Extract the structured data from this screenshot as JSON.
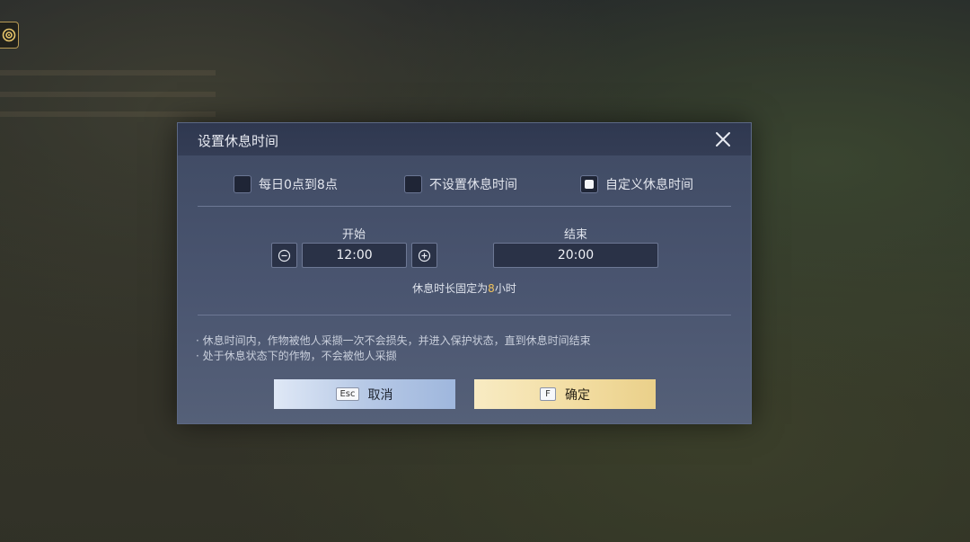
{
  "dialog": {
    "title": "设置休息时间",
    "options": [
      {
        "label": "每日0点到8点",
        "checked": false
      },
      {
        "label": "不设置休息时间",
        "checked": false
      },
      {
        "label": "自定义休息时间",
        "checked": true
      }
    ],
    "start": {
      "label": "开始",
      "value": "12:00"
    },
    "end": {
      "label": "结束",
      "value": "20:00"
    },
    "duration": {
      "prefix": "休息时长固定为",
      "hours": "8",
      "suffix": "小时"
    },
    "notes": [
      "· 休息时间内，作物被他人采撷一次不会损失，并进入保护状态，直到休息时间结束",
      "· 处于休息状态下的作物，不会被他人采撷"
    ],
    "cancel": {
      "key": "Esc",
      "label": "取消"
    },
    "confirm": {
      "key": "F",
      "label": "确定"
    }
  },
  "colors": {
    "highlight": "#f0c25c",
    "accent_gold": "#b89a55"
  },
  "icons": [
    "target-icon",
    "close-icon",
    "minus-circle-icon",
    "plus-circle-icon"
  ]
}
